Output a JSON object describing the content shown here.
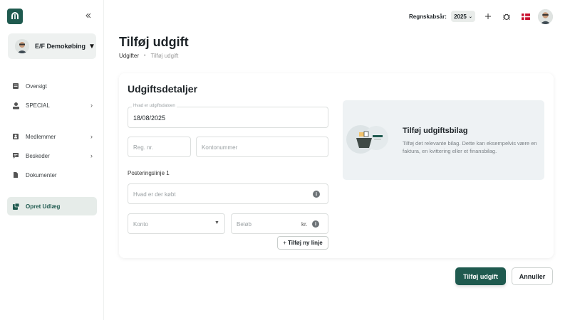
{
  "sidebar": {
    "org_name": "E/F Demokøbing",
    "items": [
      {
        "label": "Oversigt"
      },
      {
        "label": "SPECIAL"
      },
      {
        "label": "Medlemmer"
      },
      {
        "label": "Beskeder"
      },
      {
        "label": "Dokumenter"
      },
      {
        "label": "Opret Udlæg"
      }
    ]
  },
  "topbar": {
    "fiscal_year_label": "Regnskabsår:",
    "fiscal_year_value": "2025"
  },
  "page": {
    "title": "Tilføj udgift",
    "breadcrumb": [
      "Udgifter",
      "Tilføj udgift"
    ]
  },
  "form": {
    "section_title": "Udgiftsdetaljer",
    "date_label": "Hvad er udgiftsdatoen",
    "date_value": "18/08/2025",
    "reg_placeholder": "Reg. nr.",
    "account_number_placeholder": "Kontonummer",
    "posting_line_label": "Posteringslinje 1",
    "what_bought_placeholder": "Hvad er der købt",
    "account_placeholder": "Konto",
    "amount_placeholder": "Beløb",
    "currency": "kr.",
    "add_line_label": "Tilføj ny linje"
  },
  "attachment": {
    "title": "Tilføj udgiftsbilag",
    "description": "Tilføj det relevante bilag. Dette kan eksempelvis være en faktura, en kvittering eller et finansbilag."
  },
  "actions": {
    "submit_label": "Tilføj udgift",
    "cancel_label": "Annuller"
  },
  "colors": {
    "brand": "#1f5a4f",
    "active_nav_bg": "#e6ece9"
  }
}
